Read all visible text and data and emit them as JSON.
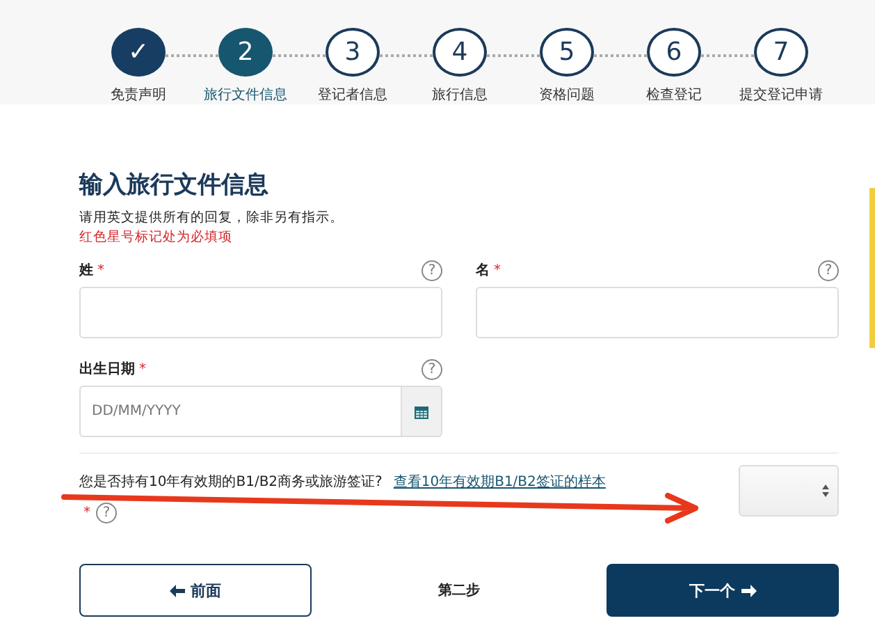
{
  "steps": [
    {
      "number": "✓",
      "label": "免责声明",
      "completed": true,
      "selected": false
    },
    {
      "number": "2",
      "label": "旅行文件信息",
      "completed": false,
      "selected": true
    },
    {
      "number": "3",
      "label": "登记者信息",
      "completed": false,
      "selected": false
    },
    {
      "number": "4",
      "label": "旅行信息",
      "completed": false,
      "selected": false
    },
    {
      "number": "5",
      "label": "资格问题",
      "completed": false,
      "selected": false
    },
    {
      "number": "6",
      "label": "检查登记",
      "completed": false,
      "selected": false
    },
    {
      "number": "7",
      "label": "提交登记申请",
      "completed": false,
      "selected": false
    }
  ],
  "form": {
    "title": "输入旅行文件信息",
    "instruction": "请用英文提供所有的回复，除非另有指示。",
    "required_note": "红色星号标记处为必填项",
    "fields": [
      {
        "label": "姓",
        "required_mark": "*",
        "help": "?",
        "kind": "text"
      },
      {
        "label": "名",
        "required_mark": "*",
        "help": "?",
        "kind": "text"
      },
      {
        "label": "出生日期",
        "required_mark": "*",
        "help": "?",
        "kind": "date",
        "placeholder": "DD/MM/YYYY"
      }
    ],
    "question": {
      "text": "您是否持有10年有效期的B1/B2商务或旅游签证?",
      "link": "查看10年有效期B1/B2签证的样本",
      "required_mark": "*",
      "help": "?"
    }
  },
  "annotation": {
    "kind": "arrow",
    "color": "#e8381c"
  },
  "footer": {
    "back": "前面",
    "step": "第二步",
    "next": "下一个"
  }
}
